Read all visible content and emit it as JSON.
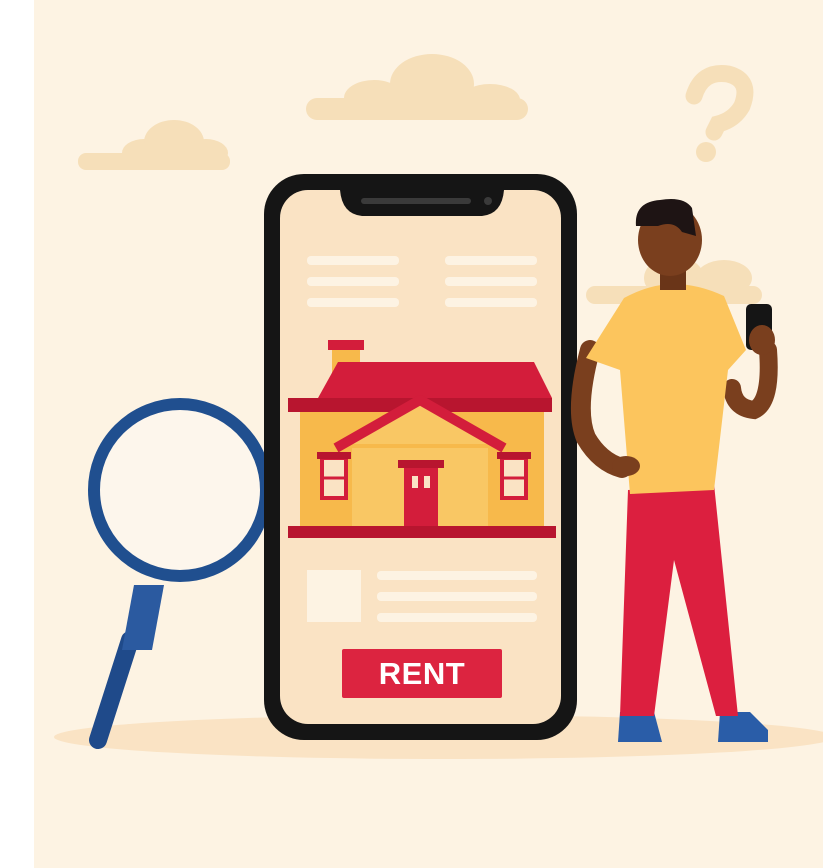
{
  "scene": {
    "illustration": "house-rental-search",
    "colors": {
      "background": "#fdf3e3",
      "cloud": "#f6dfb9",
      "phone_frame": "#151515",
      "phone_screen": "#fae3c4",
      "placeholder_line": "#fdf3e3",
      "roof": "#d31d3b",
      "house_wall": "#f7b94b",
      "shirt": "#fcc55d",
      "pants": "#dc1f3f",
      "skin": "#7a3f1e",
      "magnifier_ring": "#204f8f"
    }
  },
  "phone": {
    "rent_button_label": "RENT"
  }
}
